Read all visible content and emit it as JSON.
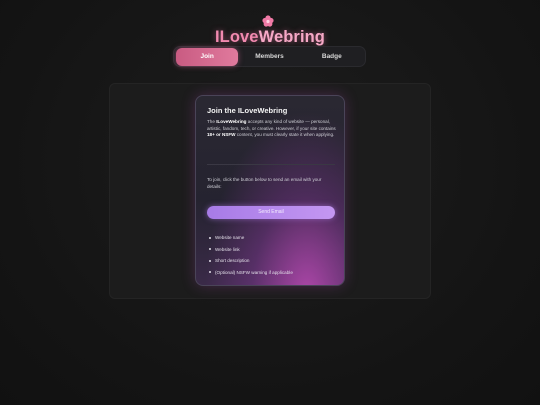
{
  "header": {
    "logo_icon": "flower-icon",
    "title_part1": "ILove",
    "title_part2": "Webring",
    "accent_color": "#f28ab0"
  },
  "nav": {
    "items": [
      {
        "label": "Join",
        "active": true
      },
      {
        "label": "Members",
        "active": false
      },
      {
        "label": "Badge",
        "active": false
      }
    ]
  },
  "card": {
    "title": "Join the ILoveWebring",
    "desc_prefix": "The ",
    "desc_bold1": "ILoveWebring",
    "desc_mid": " accepts any kind of website — personal, artistic, fandom, tech, or creative. However, if your site contains ",
    "desc_bold2": "18+ or NSFW",
    "desc_suffix": " content, you must clearly state it when applying.",
    "join_text": "To join, click the button below to send an email with your details:",
    "button_label": "Send Email",
    "button_color": "#b58aee",
    "requirements": [
      "Website name",
      "Website link",
      "Short description",
      "(Optional) NSFW warning if applicable"
    ]
  }
}
